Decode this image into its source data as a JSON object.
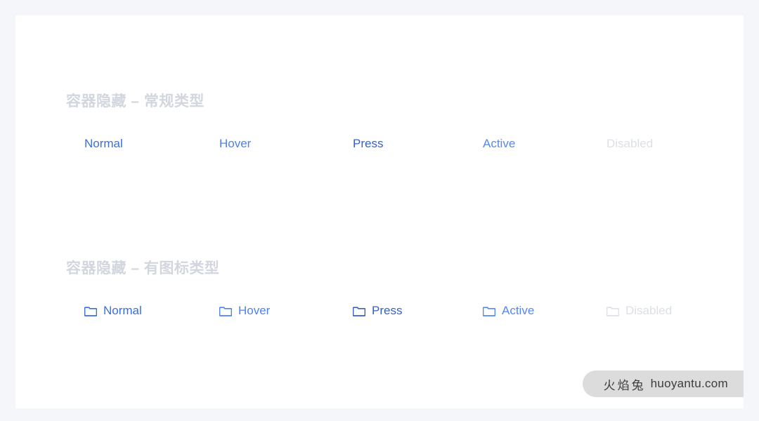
{
  "page": {
    "background": "#f4f6fa",
    "canvas_background": "#ffffff"
  },
  "sections": [
    {
      "id": "plain-type",
      "title": "容器隐藏 – 常规类型",
      "title_color": "#d3d6de",
      "has_icons": false,
      "items": [
        {
          "state": "normal",
          "label": "Normal",
          "color": "#3a6fd8"
        },
        {
          "state": "hover",
          "label": "Hover",
          "color": "#4f82e8"
        },
        {
          "state": "press",
          "label": "Press",
          "color": "#3461c4"
        },
        {
          "state": "active",
          "label": "Active",
          "color": "#5488ef"
        },
        {
          "state": "disabled",
          "label": "Disabled",
          "color": "#dcdfe6"
        }
      ]
    },
    {
      "id": "icon-type",
      "title": "容器隐藏 – 有图标类型",
      "title_color": "#d3d6de",
      "has_icons": true,
      "items": [
        {
          "state": "normal",
          "label": "Normal",
          "color": "#3a6fd8",
          "icon": "folder-icon"
        },
        {
          "state": "hover",
          "label": "Hover",
          "color": "#4f82e8",
          "icon": "folder-icon"
        },
        {
          "state": "press",
          "label": "Press",
          "color": "#3461c4",
          "icon": "folder-icon"
        },
        {
          "state": "active",
          "label": "Active",
          "color": "#5488ef",
          "icon": "folder-icon"
        },
        {
          "state": "disabled",
          "label": "Disabled",
          "color": "#dcdfe6",
          "icon": "folder-icon"
        }
      ]
    }
  ],
  "watermark": {
    "cn": "火焰兔",
    "domain": "huoyantu.com",
    "background": "#dcdcdc",
    "color": "#3d3d3d"
  }
}
